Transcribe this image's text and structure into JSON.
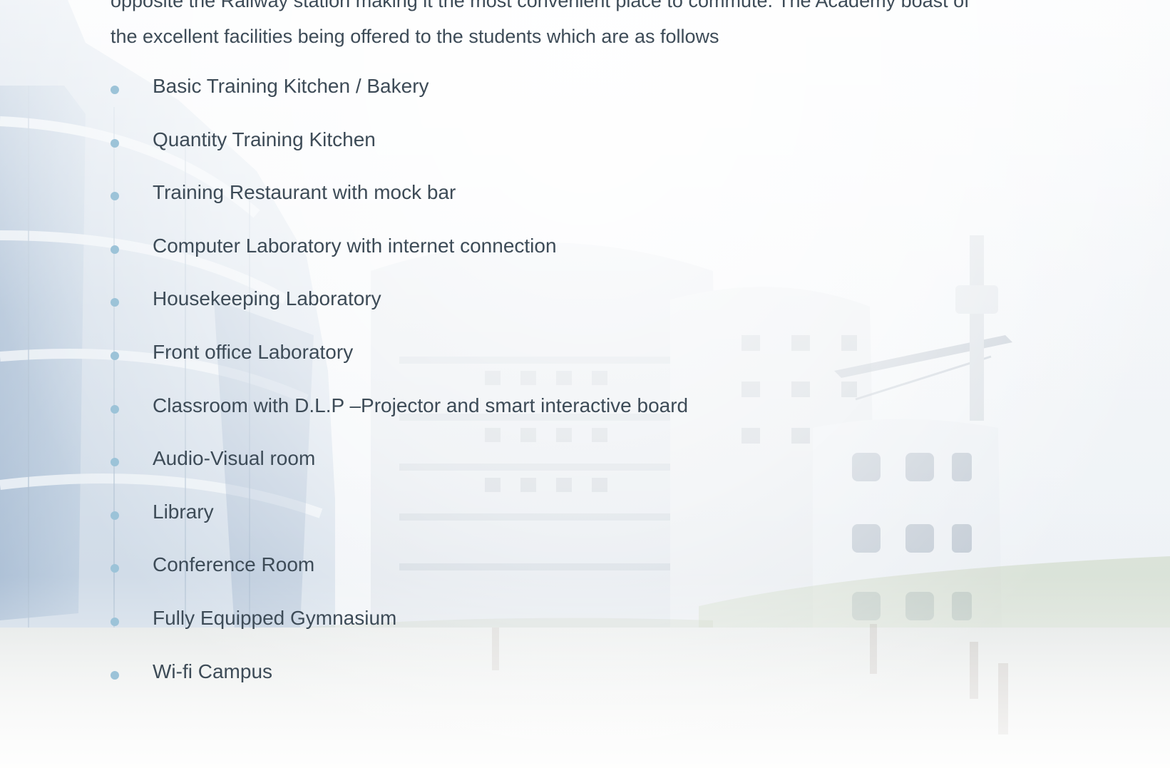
{
  "intro_lines": [
    "opposite the Railway station making it the most convenient place to commute. The Academy boast of",
    "the excellent facilities being offered to the students which are as follows"
  ],
  "facilities": [
    "Basic Training Kitchen / Bakery",
    "Quantity Training Kitchen",
    "Training Restaurant with mock bar",
    "Computer Laboratory with internet connection",
    "Housekeeping Laboratory",
    "Front office Laboratory",
    "Classroom with D.L.P –Projector and smart interactive board",
    "Audio-Visual room",
    "Library",
    "Conference Room",
    "Fully Equipped Gymnasium",
    "Wi-fi Campus"
  ],
  "colors": {
    "text": "#3d4b57",
    "bullet": "#9cc3d8"
  },
  "background": {
    "icon": "campus-building-illustration"
  }
}
